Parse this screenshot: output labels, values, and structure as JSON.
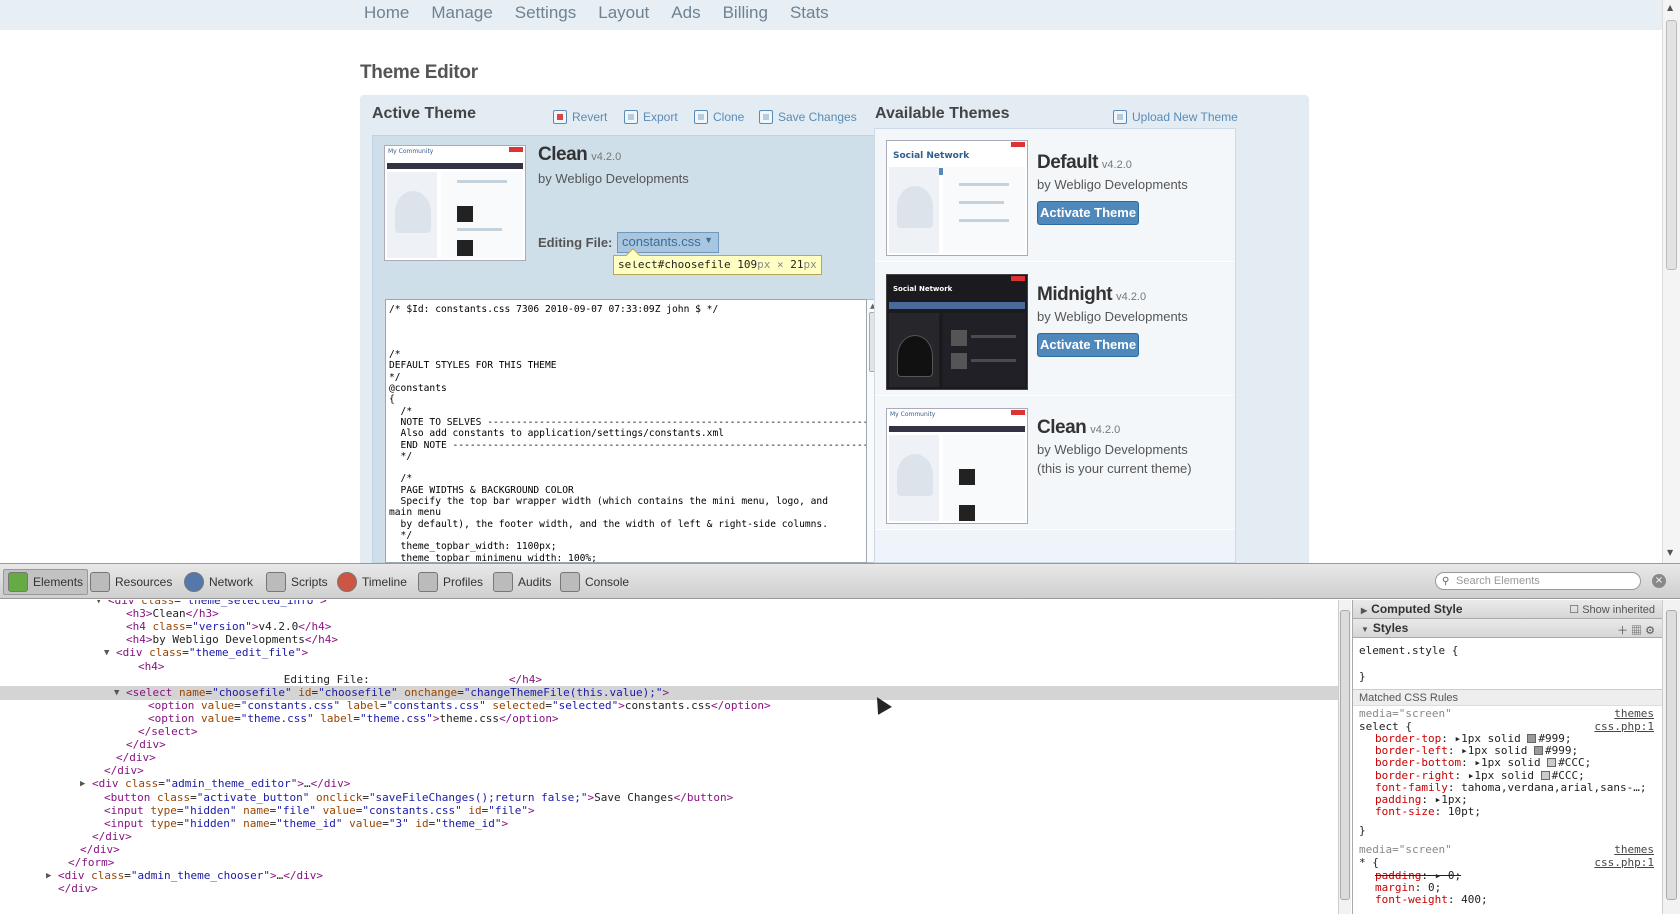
{
  "nav": {
    "items": [
      "Home",
      "Manage",
      "Settings",
      "Layout",
      "Ads",
      "Billing",
      "Stats"
    ]
  },
  "page_title": "Theme Editor",
  "active": {
    "heading": "Active Theme",
    "tools": {
      "revert": "Revert",
      "export": "Export",
      "clone": "Clone",
      "save": "Save Changes"
    },
    "theme_name": "Clean",
    "version": "v4.2.0",
    "author": "by Webligo Developments",
    "editing_label": "Editing File:",
    "file_select_value": "constants.css",
    "inspector_tip": {
      "selector": "select#choosefile",
      "w": "109",
      "unit": "px",
      "sep": "×",
      "h": "21"
    },
    "thumb_title": "My Community",
    "code": "/* $Id: constants.css 7306 2010-09-07 07:33:09Z john $ */\n\n\n\n/*\nDEFAULT STYLES FOR THIS THEME\n*/\n@constants\n{\n  /*\n  NOTE TO SELVES ------------------------------------------------------------------\n  Also add constants to application/settings/constants.xml\n  END NOTE ------------------------------------------------------------------------\n  */\n\n  /*\n  PAGE WIDTHS & BACKGROUND COLOR\n  Specify the top bar wrapper width (which contains the mini menu, logo, and\nmain menu\n  by default), the footer width, and the width of left & right-side columns.\n  */\n  theme_topbar_width: 1100px;\n  theme_topbar_minimenu_width: 100%;"
  },
  "available": {
    "heading": "Available Themes",
    "upload": "Upload New Theme",
    "themes": [
      {
        "name": "Default",
        "version": "v4.2.0",
        "author": "by Webligo Developments",
        "button": "Activate Theme",
        "thumb_title": "Social Network"
      },
      {
        "name": "Midnight",
        "version": "v4.2.0",
        "author": "by Webligo Developments",
        "button": "Activate Theme",
        "thumb_title": "Social Network"
      },
      {
        "name": "Clean",
        "version": "v4.2.0",
        "author": "by Webligo Developments",
        "note": "(this is your current theme)",
        "thumb_title": "My Community"
      }
    ]
  },
  "devtools": {
    "tabs": [
      "Elements",
      "Resources",
      "Network",
      "Scripts",
      "Timeline",
      "Profiles",
      "Audits",
      "Console"
    ],
    "search_placeholder": "Search Elements",
    "dom": [
      {
        "tri": "▼",
        "text": "<div class=\"theme_selected_info\">"
      },
      {
        "tri": "",
        "text": "<h3>Clean</h3>"
      },
      {
        "tri": "",
        "text": "<h4 class=\"version\">v4.2.0</h4>"
      },
      {
        "tri": "",
        "text": "<h4>by Webligo Developments</h4>"
      },
      {
        "tri": "▼",
        "text": "<div class=\"theme_edit_file\">"
      },
      {
        "tri": "",
        "text": "<h4>"
      },
      {
        "tri": "",
        "text": "                      Editing File:                     </h4>"
      },
      {
        "tri": "▼",
        "text": "<select name=\"choosefile\" id=\"choosefile\" onchange=\"changeThemeFile(this.value);\">"
      },
      {
        "tri": "",
        "text": "<option value=\"constants.css\" label=\"constants.css\" selected=\"selected\">constants.css</option>"
      },
      {
        "tri": "",
        "text": "<option value=\"theme.css\" label=\"theme.css\">theme.css</option>"
      },
      {
        "tri": "",
        "text": "</select>"
      },
      {
        "tri": "",
        "text": "</div>"
      },
      {
        "tri": "",
        "text": "</div>"
      },
      {
        "tri": "",
        "text": "</div>"
      },
      {
        "tri": "▶",
        "text": "<div class=\"admin_theme_editor\">…</div>"
      },
      {
        "tri": "",
        "text": "<button class=\"activate_button\" onclick=\"saveFileChanges();return false;\">Save Changes</button>"
      },
      {
        "tri": "",
        "text": "<input type=\"hidden\" name=\"file\" value=\"constants.css\" id=\"file\">"
      },
      {
        "tri": "",
        "text": "<input type=\"hidden\" name=\"theme_id\" value=\"3\" id=\"theme_id\">"
      },
      {
        "tri": "",
        "text": "</div>"
      },
      {
        "tri": "",
        "text": "</div>"
      },
      {
        "tri": "",
        "text": "</form>"
      },
      {
        "tri": "▶",
        "text": "<div class=\"admin_theme_chooser\">…</div>"
      },
      {
        "tri": "",
        "text": "</div>"
      }
    ],
    "sidebar": {
      "computed": "Computed Style",
      "show_inherited": "Show inherited",
      "styles": "Styles",
      "element_style": "element.style {",
      "element_close": "}",
      "matched": "Matched CSS Rules",
      "media1": "media=\"screen\"",
      "link1a": "themes",
      "link1b": "css.php:1",
      "sel1": "select {",
      "props1": [
        {
          "name": "border-top",
          "value": "1px solid",
          "color": "#999"
        },
        {
          "name": "border-left",
          "value": "1px solid",
          "color": "#999"
        },
        {
          "name": "border-bottom",
          "value": "1px solid",
          "color": "#CCC"
        },
        {
          "name": "border-right",
          "value": "1px solid",
          "color": "#CCC"
        },
        {
          "name": "font-family",
          "value": "tahoma,verdana,arial,sans-…"
        },
        {
          "name": "padding",
          "value": "1px"
        },
        {
          "name": "font-size",
          "value": "10pt"
        }
      ],
      "close1": "}",
      "media2": "media=\"screen\"",
      "link2a": "themes",
      "link2b": "css.php:1",
      "sel2": "* {",
      "props2": [
        {
          "name": "padding",
          "value": "0",
          "struck": true
        },
        {
          "name": "margin",
          "value": "0"
        },
        {
          "name": "font-weight",
          "value": "400"
        }
      ]
    }
  }
}
